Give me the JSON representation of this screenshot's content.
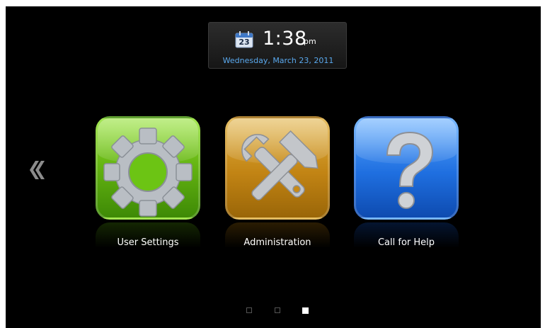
{
  "clock": {
    "calendar_day": "23",
    "time": "1:38",
    "ampm": "pm",
    "date": "Wednesday, March 23, 2011"
  },
  "navigation": {
    "previous_icon": "chevron-left-icon"
  },
  "tiles": [
    {
      "label": "User Settings",
      "icon": "gear-icon",
      "color": "#6cc414"
    },
    {
      "label": "Administration",
      "icon": "hammer-wrench-icon",
      "color": "#c88a18"
    },
    {
      "label": "Call for Help",
      "icon": "question-mark-icon",
      "color": "#1f6fe0"
    }
  ],
  "pager": {
    "pages": 3,
    "current": 3
  },
  "colors": {
    "background": "#000000",
    "date_text": "#5aa9ee"
  }
}
